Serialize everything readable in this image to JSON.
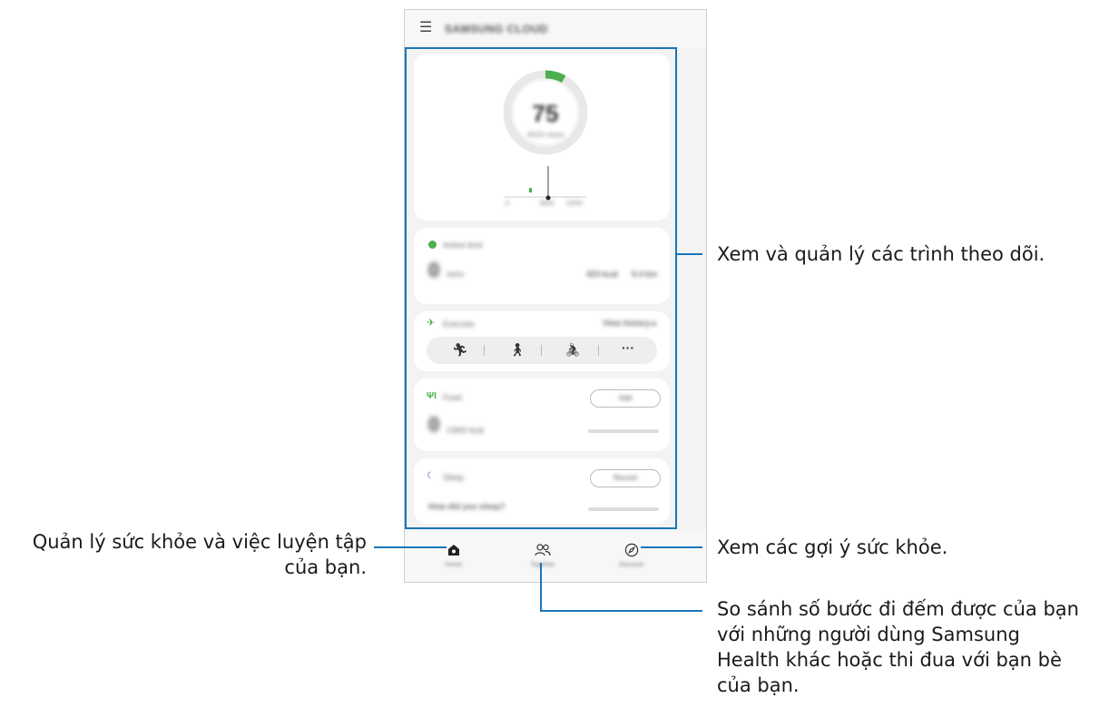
{
  "app": {
    "title": "SAMSUNG CLOUD"
  },
  "tracker": {
    "steps_value": "75",
    "steps_caption": "/6000 steps",
    "axis_start": "0",
    "axis_mid": "6000",
    "axis_end": "100%",
    "progress": 0.08
  },
  "active_time": {
    "title": "Active time",
    "value": "0",
    "unit": "mins",
    "stat_1": "423 kcal",
    "stat_2": "5.4 km"
  },
  "exercise": {
    "title": "Exercise",
    "link": "View history ▸",
    "icons": [
      "running-icon",
      "walking-icon",
      "cycling-icon",
      "more-icon"
    ],
    "more_label": "···"
  },
  "food": {
    "title": "Food",
    "button": "Add",
    "value": "0",
    "unit": "/1800 kcal"
  },
  "sleep": {
    "title": "Sleep",
    "button": "Record",
    "question": "How did you sleep?"
  },
  "nav": {
    "home": "Home",
    "together": "Together",
    "discover": "Discover"
  },
  "callouts": {
    "trackers": "Xem và quản lý các trình theo dõi.",
    "home_line1": "Quản lý sức khỏe và việc luyện tập",
    "home_line2": "của bạn.",
    "discover": "Xem các gợi ý sức khỏe.",
    "together_line1": "So sánh số bước đi đếm được của bạn",
    "together_line2": "với những người dùng Samsung",
    "together_line3": "Health khác hoặc thi đua với bạn bè",
    "together_line4": "của bạn."
  },
  "colors": {
    "accent": "#1976b9",
    "step_green": "#4caf50",
    "sleep_blue": "#5c6bc0"
  }
}
